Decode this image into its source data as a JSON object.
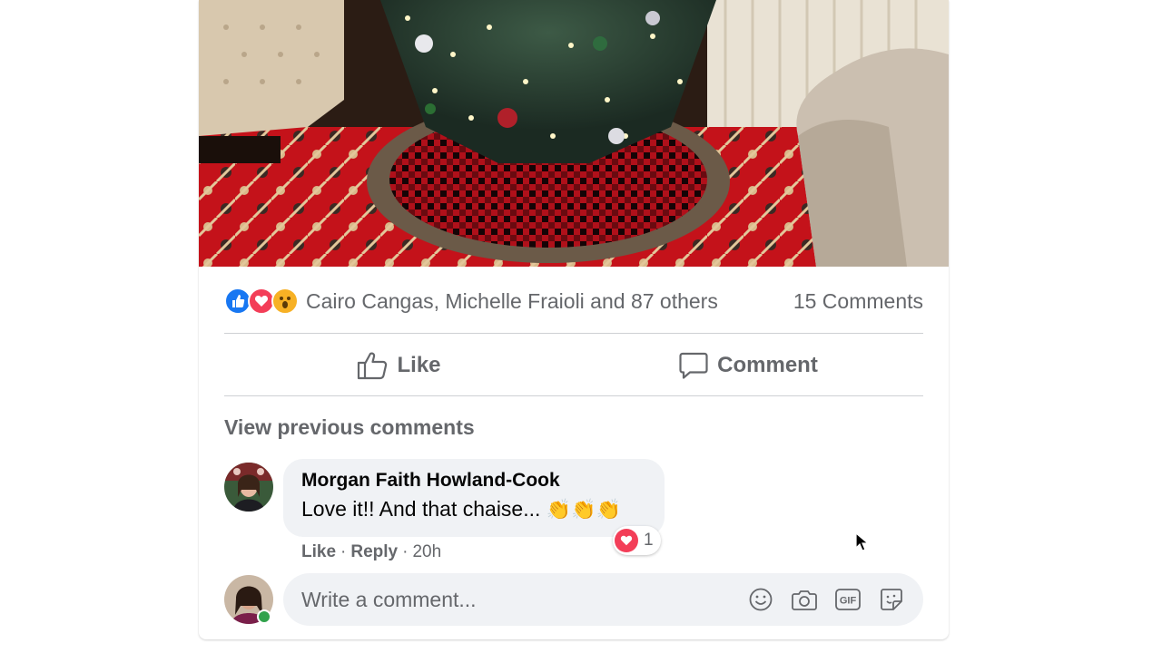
{
  "post": {
    "photo_alt": "christmas-tree-photo",
    "reactions": {
      "icons": [
        "like-reaction-icon",
        "love-reaction-icon",
        "wow-reaction-icon"
      ],
      "summary": "Cairo Cangas, Michelle Fraioli and 87 others",
      "comments_count": "15 Comments"
    },
    "actions": {
      "like_label": "Like",
      "comment_label": "Comment"
    },
    "view_previous": "View previous comments",
    "comments": [
      {
        "author": "Morgan Faith Howland-Cook",
        "text": "Love it!! And that chaise...",
        "emoji": "👏👏👏",
        "reaction_count": "1",
        "like": "Like",
        "reply": "Reply",
        "time": "20h"
      }
    ],
    "composer": {
      "placeholder": "Write a comment..."
    }
  },
  "colors": {
    "like_blue": "#1877f2",
    "love_red": "#f33e58",
    "wow_yellow": "#f7b125",
    "secondary_text": "#65676b",
    "online_green": "#31a24c"
  }
}
